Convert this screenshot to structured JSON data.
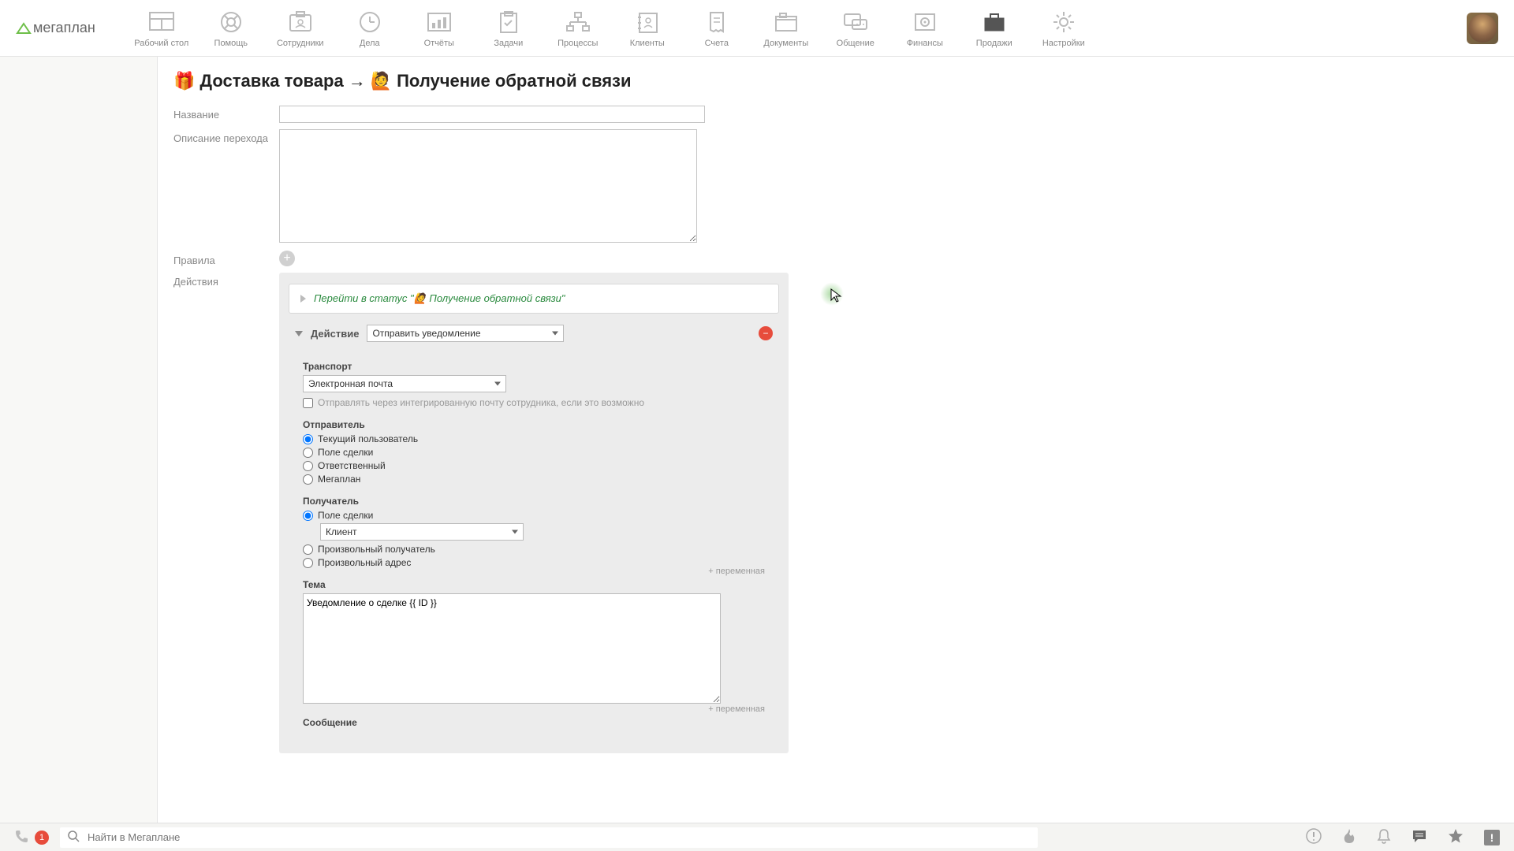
{
  "logo_text": "мегаплан",
  "nav": [
    {
      "label": "Рабочий стол"
    },
    {
      "label": "Помощь"
    },
    {
      "label": "Сотрудники"
    },
    {
      "label": "Дела"
    },
    {
      "label": "Отчёты"
    },
    {
      "label": "Задачи"
    },
    {
      "label": "Процессы"
    },
    {
      "label": "Клиенты"
    },
    {
      "label": "Счета"
    },
    {
      "label": "Документы"
    },
    {
      "label": "Общение"
    },
    {
      "label": "Финансы"
    },
    {
      "label": "Продажи"
    },
    {
      "label": "Настройки"
    }
  ],
  "page_title": {
    "icon1": "🎁",
    "part1": "Доставка товара",
    "arrow": "→",
    "icon2": "🙋",
    "part2": "Получение обратной связи"
  },
  "labels": {
    "name": "Название",
    "description": "Описание перехода",
    "rules": "Правила",
    "actions": "Действия"
  },
  "form": {
    "name_value": "",
    "description_value": ""
  },
  "status_box": {
    "prefix": "Перейти в статус \"",
    "icon": "🙋",
    "name": "Получение обратной связи",
    "suffix": "\""
  },
  "action": {
    "label": "Действие",
    "select_value": "Отправить уведомление",
    "transport": {
      "title": "Транспорт",
      "select_value": "Электронная почта",
      "checkbox_label": "Отправлять через интегрированную почту сотрудника, если это возможно"
    },
    "sender": {
      "title": "Отправитель",
      "options": [
        "Текущий пользователь",
        "Поле сделки",
        "Ответственный",
        "Мегаплан"
      ],
      "selected": 0
    },
    "recipient": {
      "title": "Получатель",
      "option1": "Поле сделки",
      "field_select": "Клиент",
      "option2": "Произвольный получатель",
      "option3": "Произвольный адрес",
      "selected": 0
    },
    "subject": {
      "title": "Тема",
      "plus_var": "+ переменная",
      "value": "Уведомление о сделке {{ ID }}"
    },
    "message": {
      "title": "Сообщение",
      "plus_var": "+ переменная"
    }
  },
  "bottom": {
    "phone_badge": "1",
    "search_placeholder": "Найти в Мегаплане"
  }
}
